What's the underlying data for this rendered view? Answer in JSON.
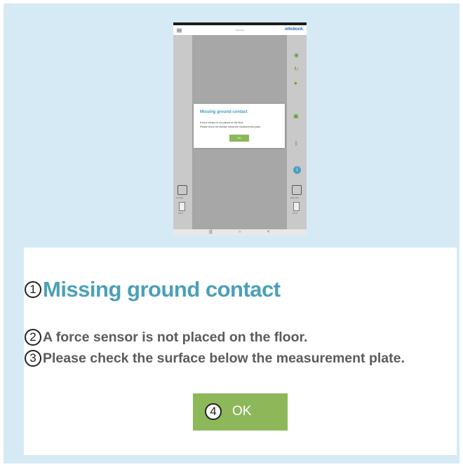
{
  "tablet": {
    "header_title": "Sole view",
    "brand": "ottobock.",
    "dialog": {
      "title": "Missing ground contact",
      "line1": "A force sensor is not placed on the floor.",
      "line2": "Please check the surface below the measurement plate.",
      "ok": "OK"
    },
    "left_plate_label": "Left plate",
    "right_plate_label": "Right plate",
    "left_battery": "100 %",
    "right_battery": "100 %",
    "nav": {
      "recent": "|||",
      "home": "○",
      "back": "<"
    }
  },
  "callout": {
    "markers": [
      "1",
      "2",
      "3",
      "4"
    ],
    "title": "Missing ground contact",
    "line1": "A force sensor is not placed on the floor.",
    "line2": "Please check the surface below the measurement plate.",
    "ok": "OK"
  },
  "colors": {
    "background": "#d5eaf4",
    "title": "#4ba0b8",
    "ok_button": "#8cb85a",
    "text": "#5b5b5b"
  },
  "icons": [
    "menu-icon",
    "eye-icon",
    "eye-rotate-icon",
    "person-icon",
    "camera-icon",
    "bluetooth-icon",
    "info-icon",
    "plate-icon",
    "battery-icon"
  ]
}
